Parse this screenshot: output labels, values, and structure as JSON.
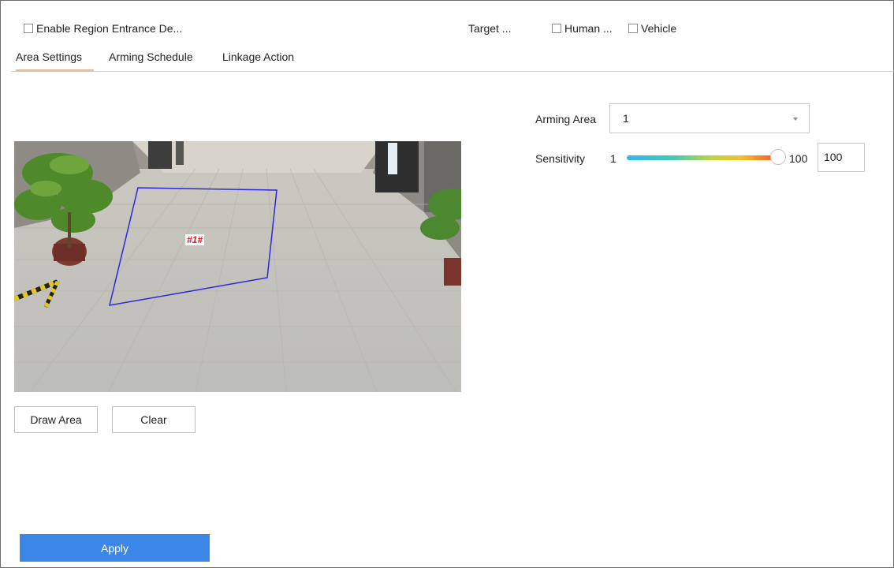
{
  "header": {
    "enable_label": "Enable Region Entrance De...",
    "target_label": "Target ...",
    "human_label": "Human ...",
    "vehicle_label": "Vehicle"
  },
  "tabs": [
    {
      "label": "Area Settings",
      "active": true
    },
    {
      "label": "Arming Schedule",
      "active": false
    },
    {
      "label": "Linkage Action",
      "active": false
    }
  ],
  "video": {
    "region_label": "#1#"
  },
  "buttons": {
    "draw_area": "Draw Area",
    "clear": "Clear",
    "apply": "Apply"
  },
  "settings": {
    "arming_area_label": "Arming Area",
    "arming_area_value": "1",
    "sensitivity_label": "Sensitivity",
    "sensitivity_min": "1",
    "sensitivity_max": "100",
    "sensitivity_value": "100",
    "sensitivity_fraction": 1.0
  },
  "colors": {
    "apply_button": "#3b86e6",
    "active_tab_underline": "#e8b896",
    "region_outline": "#2a2ad8",
    "region_label": "#e0141e"
  }
}
